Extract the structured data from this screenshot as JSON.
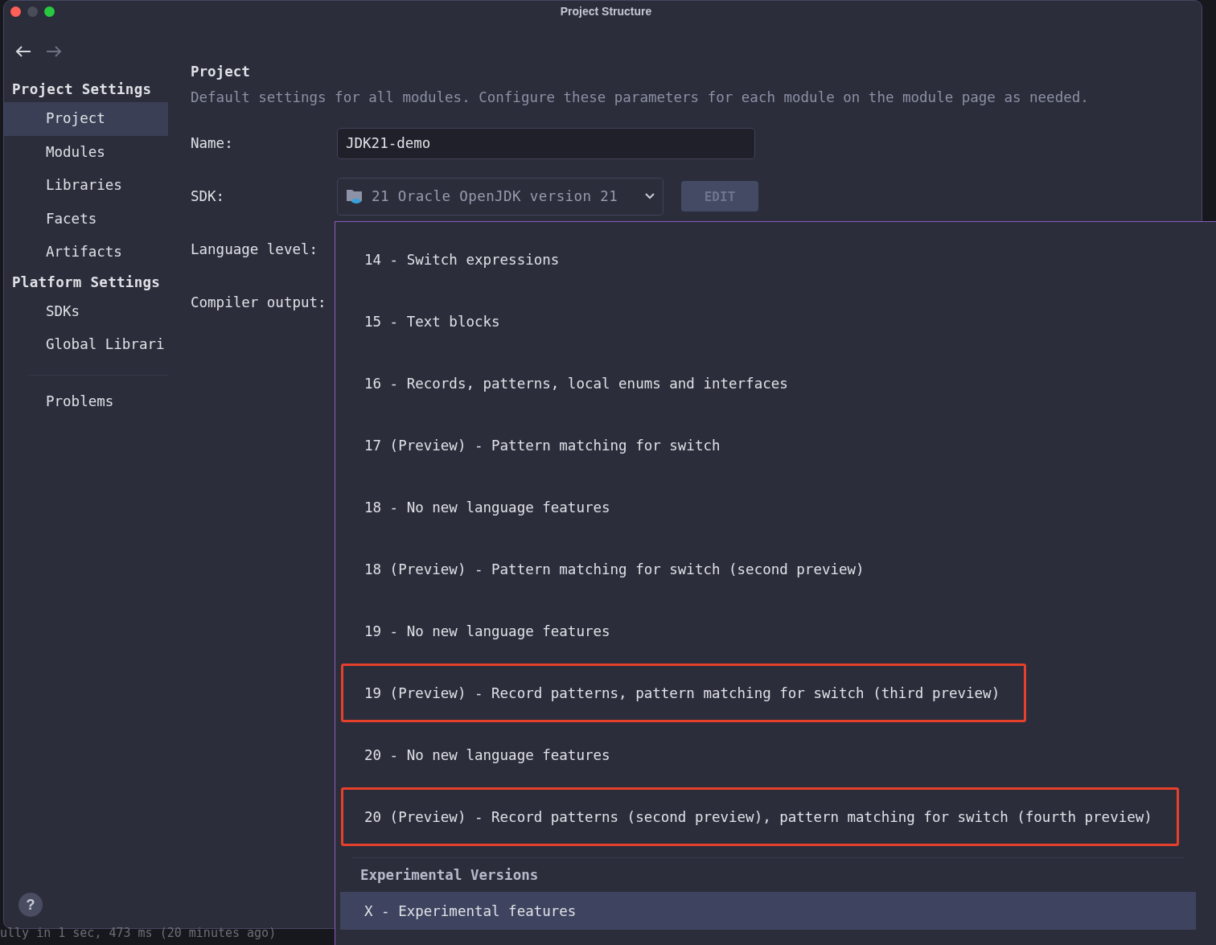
{
  "window": {
    "title": "Project Structure"
  },
  "sidebar": {
    "sections": [
      {
        "title": "Project Settings",
        "items": [
          {
            "label": "Project",
            "selected": true
          },
          {
            "label": "Modules",
            "selected": false
          },
          {
            "label": "Libraries",
            "selected": false
          },
          {
            "label": "Facets",
            "selected": false
          },
          {
            "label": "Artifacts",
            "selected": false
          }
        ]
      },
      {
        "title": "Platform Settings",
        "items": [
          {
            "label": "SDKs",
            "selected": false
          },
          {
            "label": "Global Librari",
            "selected": false
          }
        ]
      }
    ],
    "extra_items": [
      {
        "label": "Problems",
        "selected": false
      }
    ]
  },
  "content": {
    "title": "Project",
    "description": "Default settings for all modules. Configure these parameters for each module on the module page as needed.",
    "fields": [
      {
        "kind": "text",
        "label": "Name:",
        "value": "JDK21-demo"
      },
      {
        "kind": "select",
        "label": "SDK:",
        "value": "21 Oracle OpenJDK version 21",
        "button": {
          "label": "EDIT",
          "disabled": true
        }
      },
      {
        "kind": "empty",
        "label": "Language level:"
      },
      {
        "kind": "empty",
        "label": "Compiler output:"
      }
    ]
  },
  "language_level_dropdown": {
    "options": [
      {
        "label": "14 - Switch expressions",
        "selected": false,
        "highlighted": false
      },
      {
        "label": "15 - Text blocks",
        "selected": false,
        "highlighted": false
      },
      {
        "label": "16 - Records, patterns, local enums and interfaces",
        "selected": false,
        "highlighted": false
      },
      {
        "label": "17 (Preview) - Pattern matching for switch",
        "selected": false,
        "highlighted": false
      },
      {
        "label": "18 - No new language features",
        "selected": false,
        "highlighted": false
      },
      {
        "label": "18 (Preview) - Pattern matching for switch (second preview)",
        "selected": false,
        "highlighted": false
      },
      {
        "label": "19 - No new language features",
        "selected": false,
        "highlighted": false
      },
      {
        "label": "19 (Preview) - Record patterns, pattern matching for switch (third preview)",
        "selected": false,
        "highlighted": true
      },
      {
        "label": "20 - No new language features",
        "selected": false,
        "highlighted": false
      },
      {
        "label": "20 (Preview) - Record patterns (second preview), pattern matching for switch (fourth preview)",
        "selected": false,
        "highlighted": true
      }
    ],
    "experimental": {
      "title": "Experimental Versions",
      "options": [
        {
          "label": "X - Experimental features",
          "selected": true,
          "highlighted": false
        }
      ]
    }
  },
  "help_button": {
    "label": "?"
  },
  "background_status": "ully in 1 sec, 473 ms (20 minutes ago)"
}
